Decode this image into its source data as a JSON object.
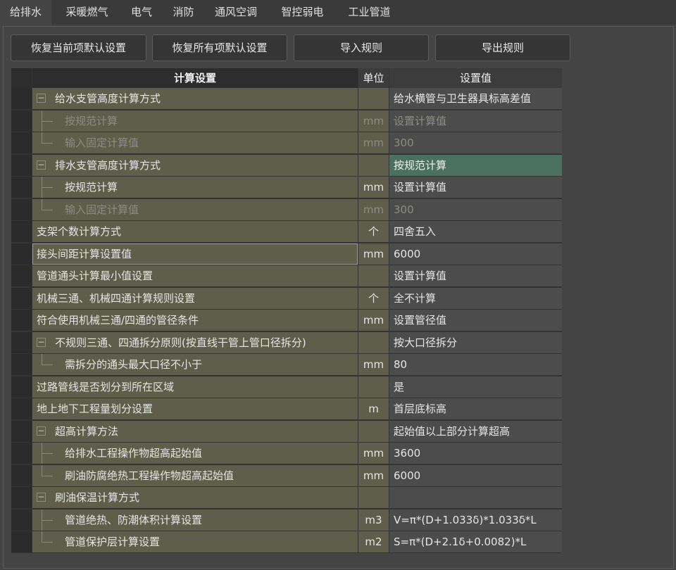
{
  "tabs": [
    "给排水",
    "采暖燃气",
    "电气",
    "消防",
    "通风空调",
    "智控弱电",
    "工业管道"
  ],
  "buttons": {
    "restore_current": "恢复当前项默认设置",
    "restore_all": "恢复所有项默认设置",
    "import_rules": "导入规则",
    "export_rules": "导出规则"
  },
  "grid": {
    "headers": {
      "name": "计算设置",
      "unit": "单位",
      "value": "设置值"
    },
    "rows": [
      {
        "name": "给水支管高度计算方式",
        "unit": "",
        "value": "给水横管与卫生器具标高差值",
        "level": 0,
        "expander": "−"
      },
      {
        "name": "按规范计算",
        "unit": "mm",
        "value": "设置计算值",
        "level": 1,
        "disabled": true
      },
      {
        "name": "输入固定计算值",
        "unit": "mm",
        "value": "300",
        "level": 1,
        "disabled": true,
        "last": true
      },
      {
        "name": "排水支管高度计算方式",
        "unit": "",
        "value": "按规范计算",
        "level": 0,
        "expander": "−",
        "selected": true
      },
      {
        "name": "按规范计算",
        "unit": "mm",
        "value": "设置计算值",
        "level": 1
      },
      {
        "name": "输入固定计算值",
        "unit": "mm",
        "value": "300",
        "level": 1,
        "disabled": true,
        "last": true
      },
      {
        "name": "支架个数计算方式",
        "unit": "个",
        "value": "四舍五入",
        "level": 0
      },
      {
        "name": "接头间距计算设置值",
        "unit": "mm",
        "value": "6000",
        "level": 0,
        "focused": true
      },
      {
        "name": "管道通头计算最小值设置",
        "unit": "",
        "value": "设置计算值",
        "level": 0
      },
      {
        "name": "机械三通、机械四通计算规则设置",
        "unit": "个",
        "value": "全不计算",
        "level": 0
      },
      {
        "name": "符合使用机械三通/四通的管径条件",
        "unit": "mm",
        "value": "设置管径值",
        "level": 0
      },
      {
        "name": "不规则三通、四通拆分原则(按直线干管上管口径拆分)",
        "unit": "",
        "value": "按大口径拆分",
        "level": 0,
        "expander": "−"
      },
      {
        "name": "需拆分的通头最大口径不小于",
        "unit": "mm",
        "value": "80",
        "level": 1,
        "last": true
      },
      {
        "name": "过路管线是否划分到所在区域",
        "unit": "",
        "value": "是",
        "level": 0
      },
      {
        "name": "地上地下工程量划分设置",
        "unit": "m",
        "value": "首层底标高",
        "level": 0
      },
      {
        "name": "超高计算方法",
        "unit": "",
        "value": "起始值以上部分计算超高",
        "level": 0,
        "expander": "−"
      },
      {
        "name": "给排水工程操作物超高起始值",
        "unit": "mm",
        "value": "3600",
        "level": 1
      },
      {
        "name": "刷油防腐绝热工程操作物超高起始值",
        "unit": "mm",
        "value": "6000",
        "level": 1,
        "last": true
      },
      {
        "name": "刷油保温计算方式",
        "unit": "",
        "value": "",
        "level": 0,
        "expander": "−"
      },
      {
        "name": "管道绝热、防潮体积计算设置",
        "unit": "m3",
        "value": "V=π*(D+1.033δ)*1.033δ*L",
        "level": 1
      },
      {
        "name": "管道保护层计算设置",
        "unit": "m2",
        "value": "S=π*(D+2.1δ+0.0082)*L",
        "level": 1,
        "last": true
      }
    ]
  }
}
